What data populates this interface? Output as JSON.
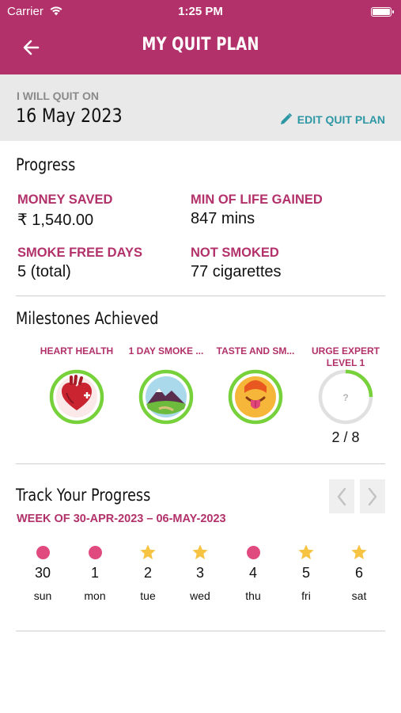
{
  "status_bar": {
    "carrier": "Carrier",
    "time": "1:25 PM"
  },
  "header": {
    "title": "MY QUIT PLAN",
    "back_icon": "arrow-left-icon",
    "color": "#b2316a"
  },
  "quit_info": {
    "label": "I WILL QUIT ON",
    "date": "16 May 2023",
    "edit_label": "EDIT QUIT PLAN",
    "edit_icon": "pencil-icon",
    "edit_color": "#2e97a4"
  },
  "progress": {
    "title": "Progress",
    "stats": [
      {
        "label": "MONEY SAVED",
        "value": "₹ 1,540.00"
      },
      {
        "label": "MIN OF LIFE GAINED",
        "value": "847 mins"
      },
      {
        "label": "SMOKE FREE DAYS",
        "value": "5 (total)"
      },
      {
        "label": "NOT SMOKED",
        "value": "77 cigarettes"
      }
    ]
  },
  "milestones": {
    "title": "Milestones Achieved",
    "items": [
      {
        "label": "HEART HEALTH",
        "icon": "heart-icon",
        "achieved": true
      },
      {
        "label": "1 DAY SMOKE ...",
        "icon": "landscape-icon",
        "achieved": true
      },
      {
        "label": "TASTE AND SM...",
        "icon": "tongue-face-icon",
        "achieved": true
      },
      {
        "label": "URGE EXPERT LEVEL 1",
        "icon": "question-icon",
        "achieved": false,
        "count": "2 / 8",
        "progress": 0.25
      }
    ]
  },
  "tracker": {
    "title": "Track Your Progress",
    "week": "WEEK OF 30-APR-2023 – 06-MAY-2023",
    "days": [
      {
        "num": "30",
        "name": "sun",
        "mark": "dot"
      },
      {
        "num": "1",
        "name": "mon",
        "mark": "dot"
      },
      {
        "num": "2",
        "name": "tue",
        "mark": "star"
      },
      {
        "num": "3",
        "name": "wed",
        "mark": "star"
      },
      {
        "num": "4",
        "name": "thu",
        "mark": "dot"
      },
      {
        "num": "5",
        "name": "fri",
        "mark": "star"
      },
      {
        "num": "6",
        "name": "sat",
        "mark": "star"
      }
    ]
  }
}
